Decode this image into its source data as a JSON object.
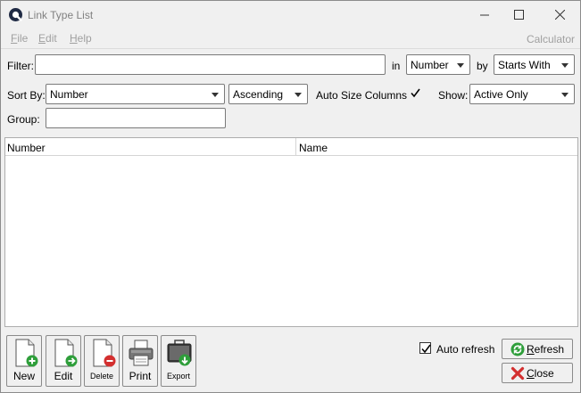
{
  "window": {
    "title": "Link Type List",
    "app_icon": "q-logo-icon"
  },
  "menu": {
    "file": "File",
    "edit": "Edit",
    "help": "Help",
    "calculator": "Calculator"
  },
  "filter": {
    "label": "Filter:",
    "value": "",
    "in_label": "in",
    "in_value": "Number",
    "by_label": "by",
    "by_value": "Starts With"
  },
  "sort": {
    "label": "Sort By:",
    "field": "Number",
    "direction": "Ascending",
    "auto_size_label": "Auto Size Columns",
    "auto_size_checked": true,
    "show_label": "Show:",
    "show_value": "Active Only"
  },
  "group": {
    "label": "Group:",
    "value": ""
  },
  "grid": {
    "columns": [
      "Number",
      "Name"
    ],
    "rows": []
  },
  "toolbar": {
    "new": "New",
    "edit": "Edit",
    "delete": "Delete",
    "print": "Print",
    "export": "Export"
  },
  "footer": {
    "auto_refresh_label": "Auto refresh",
    "auto_refresh_checked": true,
    "refresh": "Refresh",
    "close": "Close"
  },
  "colors": {
    "accent_green": "#2e9e3a",
    "danger_red": "#d32f2f"
  }
}
